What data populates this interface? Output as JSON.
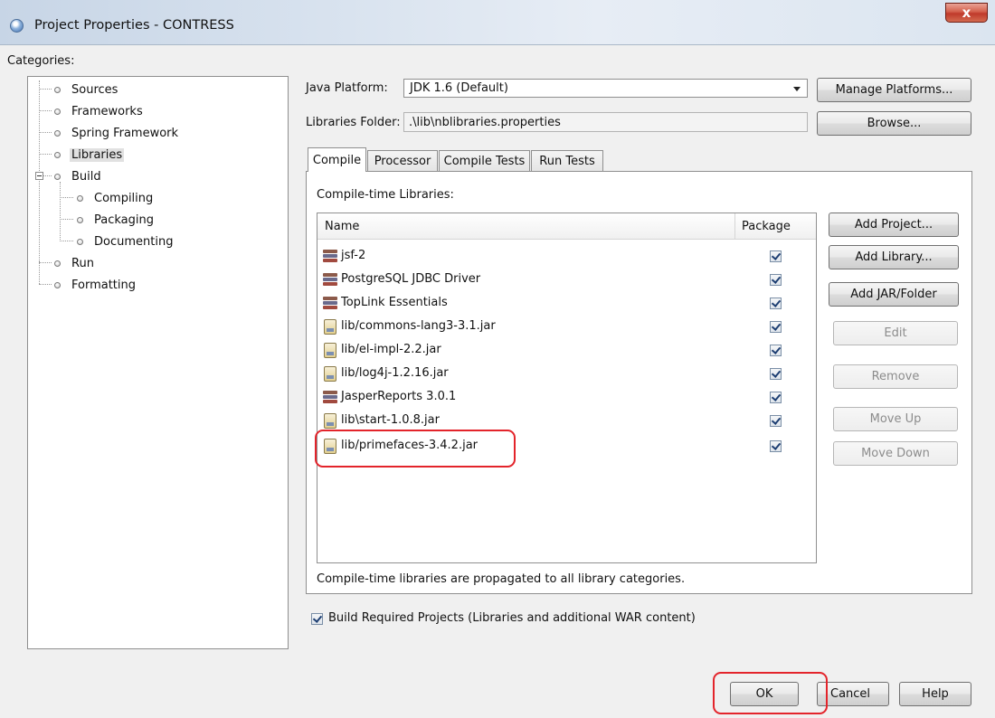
{
  "window": {
    "title": "Project Properties - CONTRESS",
    "close_label": "x"
  },
  "categories": {
    "label": "Categories:",
    "items": [
      {
        "label": "Sources",
        "level": 0,
        "selected": false
      },
      {
        "label": "Frameworks",
        "level": 0,
        "selected": false
      },
      {
        "label": "Spring Framework",
        "level": 0,
        "selected": false
      },
      {
        "label": "Libraries",
        "level": 0,
        "selected": true
      },
      {
        "label": "Build",
        "level": 0,
        "selected": false,
        "expanded": true
      },
      {
        "label": "Compiling",
        "level": 1,
        "selected": false
      },
      {
        "label": "Packaging",
        "level": 1,
        "selected": false
      },
      {
        "label": "Documenting",
        "level": 1,
        "selected": false
      },
      {
        "label": "Run",
        "level": 0,
        "selected": false
      },
      {
        "label": "Formatting",
        "level": 0,
        "selected": false
      }
    ]
  },
  "platform": {
    "label": "Java Platform:",
    "value": "JDK 1.6 (Default)",
    "manage_button": "Manage Platforms..."
  },
  "libraries_folder": {
    "label": "Libraries Folder:",
    "value": ".\\lib\\nblibraries.properties",
    "browse_button": "Browse..."
  },
  "tabs": [
    {
      "label": "Compile",
      "active": true
    },
    {
      "label": "Processor",
      "active": false
    },
    {
      "label": "Compile Tests",
      "active": false
    },
    {
      "label": "Run Tests",
      "active": false
    }
  ],
  "compile": {
    "section_label": "Compile-time Libraries:",
    "columns": [
      "Name",
      "Package"
    ],
    "rows": [
      {
        "name": "jsf-2",
        "icon": "library-icon",
        "package": true
      },
      {
        "name": "PostgreSQL JDBC Driver",
        "icon": "library-icon",
        "package": true
      },
      {
        "name": "TopLink Essentials",
        "icon": "library-icon",
        "package": true
      },
      {
        "name": "lib/commons-lang3-3.1.jar",
        "icon": "jar-icon",
        "package": true
      },
      {
        "name": "lib/el-impl-2.2.jar",
        "icon": "jar-icon",
        "package": true
      },
      {
        "name": "lib/log4j-1.2.16.jar",
        "icon": "jar-icon",
        "package": true
      },
      {
        "name": "JasperReports 3.0.1",
        "icon": "library-icon",
        "package": true
      },
      {
        "name": "lib\\start-1.0.8.jar",
        "icon": "jar-icon",
        "package": true
      },
      {
        "name": "lib/primefaces-3.4.2.jar",
        "icon": "jar-icon",
        "package": true
      }
    ],
    "buttons": {
      "add_project": "Add Project...",
      "add_library": "Add Library...",
      "add_jar": "Add JAR/Folder",
      "edit": "Edit",
      "remove": "Remove",
      "move_up": "Move Up",
      "move_down": "Move Down"
    },
    "note": "Compile-time libraries are propagated to all library categories."
  },
  "build_required": {
    "label": "Build Required Projects (Libraries and additional WAR content)",
    "checked": true
  },
  "dialog_buttons": {
    "ok": "OK",
    "cancel": "Cancel",
    "help": "Help"
  },
  "colors": {
    "annotation": "#e3242b",
    "selection": "#e1e1e1"
  }
}
